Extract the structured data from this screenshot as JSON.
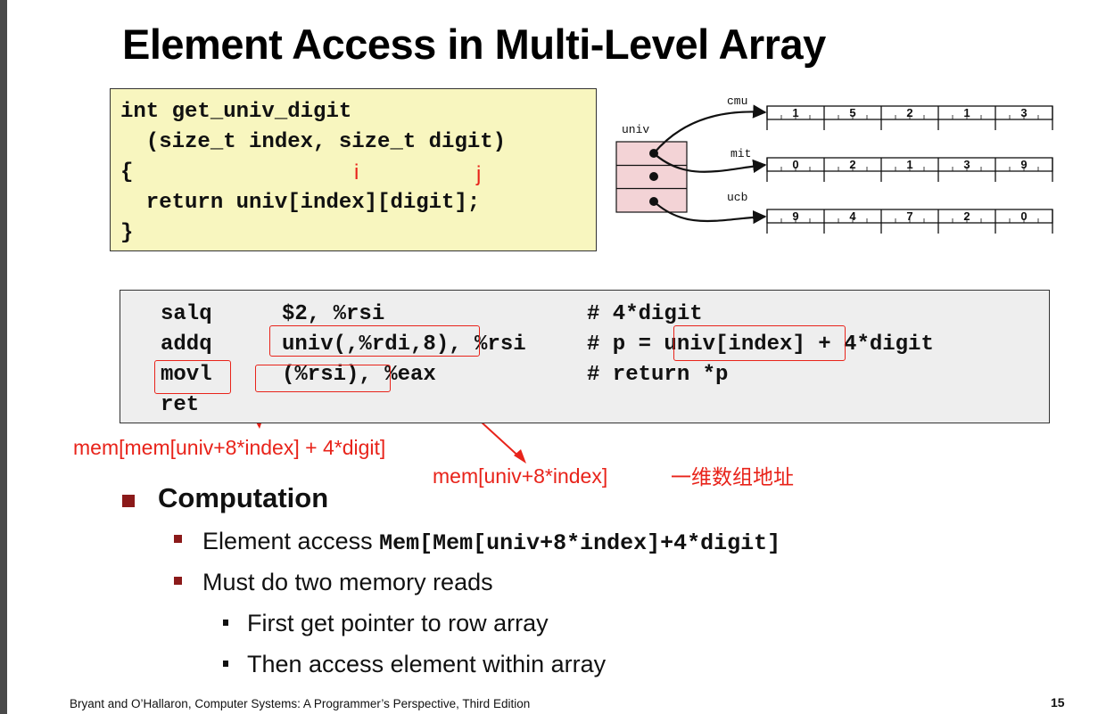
{
  "slide": {
    "title": "Element Access in Multi-Level Array",
    "page_number": "15",
    "footer": "Bryant and O’Hallaron, Computer Systems: A Programmer’s Perspective, Third Edition"
  },
  "c_code": {
    "line1": "int get_univ_digit",
    "line2": "  (size_t index, size_t digit)",
    "line3": "{",
    "line4": "  return univ[index][digit];",
    "line5": "}",
    "note_i": "i",
    "note_j": "j"
  },
  "diagram": {
    "univ_label": "univ",
    "rows": [
      {
        "name": "cmu",
        "digits": [
          "1",
          "5",
          "2",
          "1",
          "3"
        ]
      },
      {
        "name": "mit",
        "digits": [
          "0",
          "2",
          "1",
          "3",
          "9"
        ]
      },
      {
        "name": "ucb",
        "digits": [
          "9",
          "4",
          "7",
          "2",
          "0"
        ]
      }
    ],
    "pointer_fill": "#f3d3d6"
  },
  "assembly": [
    {
      "op": "salq",
      "args": "$2, %rsi",
      "comment": "# 4*digit"
    },
    {
      "op": "addq",
      "args": "univ(,%rdi,8), %rsi",
      "comment": "# p = univ[index] + 4*digit"
    },
    {
      "op": "movl",
      "args": "(%rsi), %eax",
      "comment": "# return *p"
    },
    {
      "op": "ret",
      "args": "",
      "comment": ""
    }
  ],
  "annotations": {
    "movl_note": "mem[mem[univ+8*index] + 4*digit]",
    "addr_note": "mem[univ+8*index]",
    "chinese_note": "一维数组地址",
    "color": "#e8231a"
  },
  "bullets": {
    "computation": "Computation",
    "element_access_text": "Element access ",
    "element_access_code": "Mem[Mem[univ+8*index]+4*digit]",
    "two_reads": "Must do two memory reads",
    "first": "First get pointer to row array",
    "then": "Then access element within array"
  },
  "colors": {
    "code_bg": "#f8f6bf",
    "asm_bg": "#eeeeee",
    "bullet": "#8b1a1a"
  }
}
